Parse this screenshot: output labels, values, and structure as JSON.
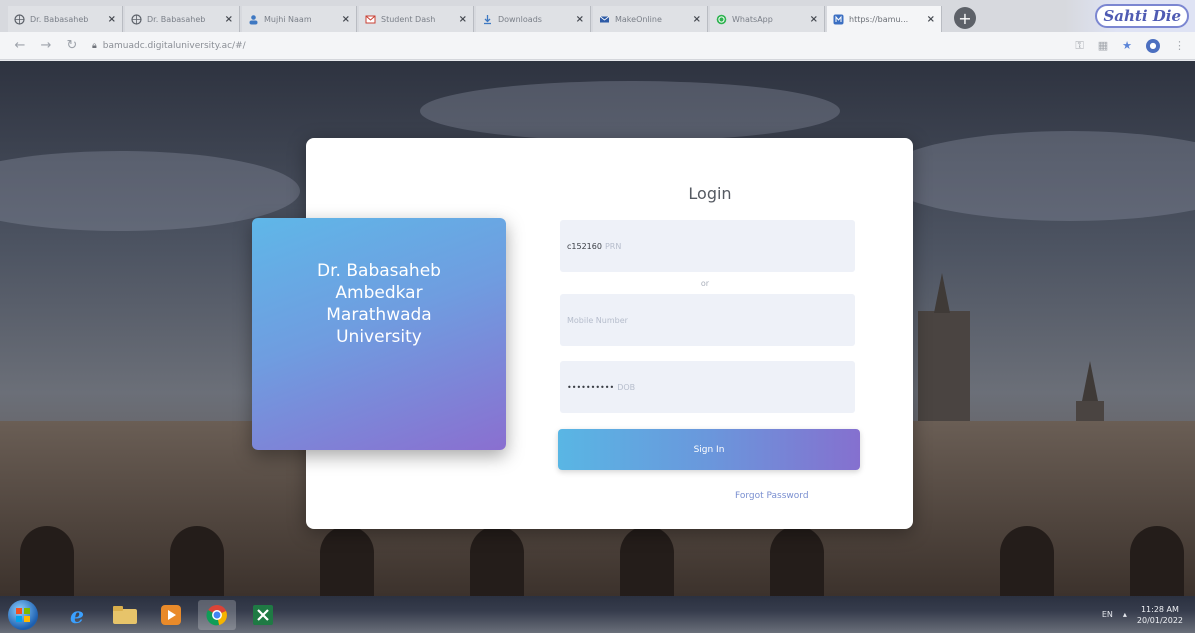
{
  "browser": {
    "tabs": [
      {
        "title": "Dr. Babasaheb",
        "icon": "globe-icon"
      },
      {
        "title": "Dr. Babasaheb",
        "icon": "globe-icon"
      },
      {
        "title": "Mujhi Naam",
        "icon": "person-icon"
      },
      {
        "title": "Student Dash",
        "icon": "gmail-icon"
      },
      {
        "title": "Downloads",
        "icon": "download-icon"
      },
      {
        "title": "MakeOnline",
        "icon": "mail-icon"
      },
      {
        "title": "WhatsApp",
        "icon": "whatsapp-icon"
      },
      {
        "title": "https://bamu...",
        "icon": "site-icon",
        "active": true
      }
    ],
    "new_tab": "+",
    "corner_badge": "Sahti Die",
    "address": "bamuadc.digitaluniversity.ac/#/",
    "accent": "#5a84d8"
  },
  "brand": {
    "lines": [
      "Dr. Babasaheb",
      "Ambedkar",
      "Marathwada",
      "University"
    ]
  },
  "login": {
    "title": "Login",
    "username_value": "c152160",
    "username_placeholder": "PRN",
    "or_text": "or",
    "mobile_placeholder": "Mobile Number",
    "password_value": "••••••••••",
    "password_placeholder": "DOB",
    "signin_label": "Sign In",
    "forgot_label": "Forgot Password"
  },
  "taskbar": {
    "lang": "EN",
    "time": "11:28 AM",
    "date": "20/01/2022"
  },
  "colors": {
    "gradient_start": "#59b6e4",
    "gradient_end": "#8570cf"
  }
}
